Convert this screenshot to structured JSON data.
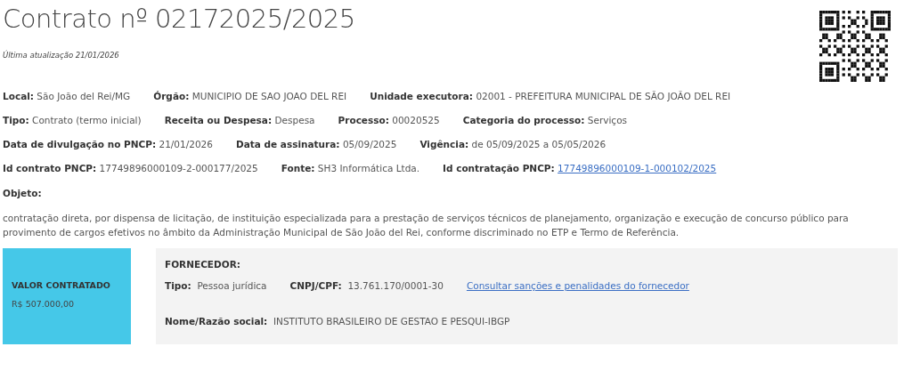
{
  "title": "Contrato nº 02172025/2025",
  "updated": "Última atualização 21/01/2026",
  "field_rows": [
    [
      {
        "label": "Local:",
        "value": "São João del Rei/MG",
        "kind": "text"
      },
      {
        "label": "Órgão:",
        "value": "MUNICIPIO DE SAO JOAO DEL REI",
        "kind": "text"
      },
      {
        "label": "Unidade executora:",
        "value": "02001 - PREFEITURA MUNICIPAL DE SÃO JOÃO DEL REI",
        "kind": "text"
      }
    ],
    [
      {
        "label": "Tipo:",
        "value": "Contrato (termo inicial)",
        "kind": "text"
      },
      {
        "label": "Receita ou Despesa:",
        "value": "Despesa",
        "kind": "text"
      },
      {
        "label": "Processo:",
        "value": "00020525",
        "kind": "text"
      },
      {
        "label": "Categoria do processo:",
        "value": "Serviços",
        "kind": "text"
      }
    ],
    [
      {
        "label": "Data de divulgação no PNCP:",
        "value": "21/01/2026",
        "kind": "text"
      },
      {
        "label": "Data de assinatura:",
        "value": "05/09/2025",
        "kind": "text"
      },
      {
        "label": "Vigência:",
        "value": "de 05/09/2025 a 05/05/2026",
        "kind": "text"
      }
    ],
    [
      {
        "label": "Id contrato PNCP:",
        "value": "17749896000109-2-000177/2025",
        "kind": "text"
      },
      {
        "label": "Fonte:",
        "value": "SH3 Informática Ltda.",
        "kind": "text"
      },
      {
        "label": "Id contratação PNCP:",
        "value": "17749896000109-1-000102/2025",
        "kind": "link"
      }
    ]
  ],
  "objeto": {
    "label": "Objeto:",
    "text": "contratação direta, por dispensa de licitação, de instituição especializada para a prestação de serviços técnicos de planejamento, organização e execução de concurso público para provimento de cargos efetivos no âmbito da Administração Municipal de São João del Rei, conforme discriminado no ETP e Termo de Referência."
  },
  "valor": {
    "label": "VALOR CONTRATADO",
    "value": "R$ 507.000,00"
  },
  "fornecedor": {
    "heading": "FORNECEDOR:",
    "fields": [
      {
        "label": "Tipo:",
        "value": "Pessoa jurídica"
      },
      {
        "label": "CNPJ/CPF:",
        "value": "13.761.170/0001-30"
      }
    ],
    "link": "Consultar sanções e penalidades do fornecedor",
    "name": {
      "label": "Nome/Razão social:",
      "value": "INSTITUTO BRASILEIRO DE GESTAO E PESQUI-IBGP"
    }
  }
}
